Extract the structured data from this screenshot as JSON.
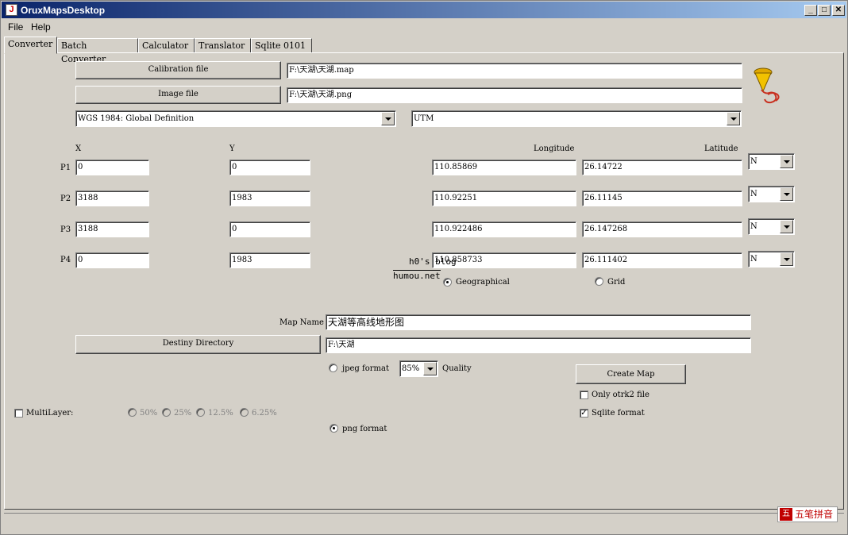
{
  "window": {
    "title": "OruxMapsDesktop",
    "minimize": "_",
    "maximize": "□",
    "close": "✕"
  },
  "menu": {
    "file": "File",
    "help": "Help"
  },
  "tabs": [
    "Converter",
    "Batch Converter",
    "Calculator",
    "Translator",
    "Sqlite 0101"
  ],
  "converter": {
    "calibration_button": "Calibration file",
    "calibration_path": "F:\\天湖\\天湖.map",
    "image_button": "Image file",
    "image_path": "F:\\天湖\\天湖.png",
    "datum": "WGS 1984: Global Definition",
    "projection": "UTM",
    "headers": {
      "x": "X",
      "y": "Y",
      "longitude": "Longitude",
      "latitude": "Latitude"
    },
    "points": [
      {
        "label": "P1",
        "x": "0",
        "y": "0",
        "lon": "110.85869",
        "lat": "26.14722",
        "hemi": "N"
      },
      {
        "label": "P2",
        "x": "3188",
        "y": "1983",
        "lon": "110.92251",
        "lat": "26.11145",
        "hemi": "N"
      },
      {
        "label": "P3",
        "x": "3188",
        "y": "0",
        "lon": "110.922486",
        "lat": "26.147268",
        "hemi": "N"
      },
      {
        "label": "P4",
        "x": "0",
        "y": "1983",
        "lon": "110.858733",
        "lat": "26.111402",
        "hemi": "N"
      }
    ],
    "coord_geographical": "Geographical",
    "coord_grid": "Grid",
    "map_name_label": "Map Name",
    "map_name": "天湖等高线地形图",
    "destiny_button": "Destiny Directory",
    "destiny_path": "F:\\天湖",
    "jpeg_label": "jpeg format",
    "quality_value": "85%",
    "quality_label": "Quality",
    "png_label": "png format",
    "create_button": "Create Map",
    "only_otrk2": "Only otrk2 file",
    "sqlite_format": "Sqlite format",
    "multilayer": "MultiLayer:",
    "layers": [
      "50%",
      "25%",
      "12.5%",
      "6.25%"
    ]
  },
  "watermark": {
    "line1": "h0's blog",
    "line2": "humou.net"
  },
  "ime": {
    "logo": "五",
    "label": "五笔拼音"
  },
  "colors": {
    "titlebar": "#0a246a",
    "background": "#d4d0c8",
    "ime": "#c00000"
  }
}
